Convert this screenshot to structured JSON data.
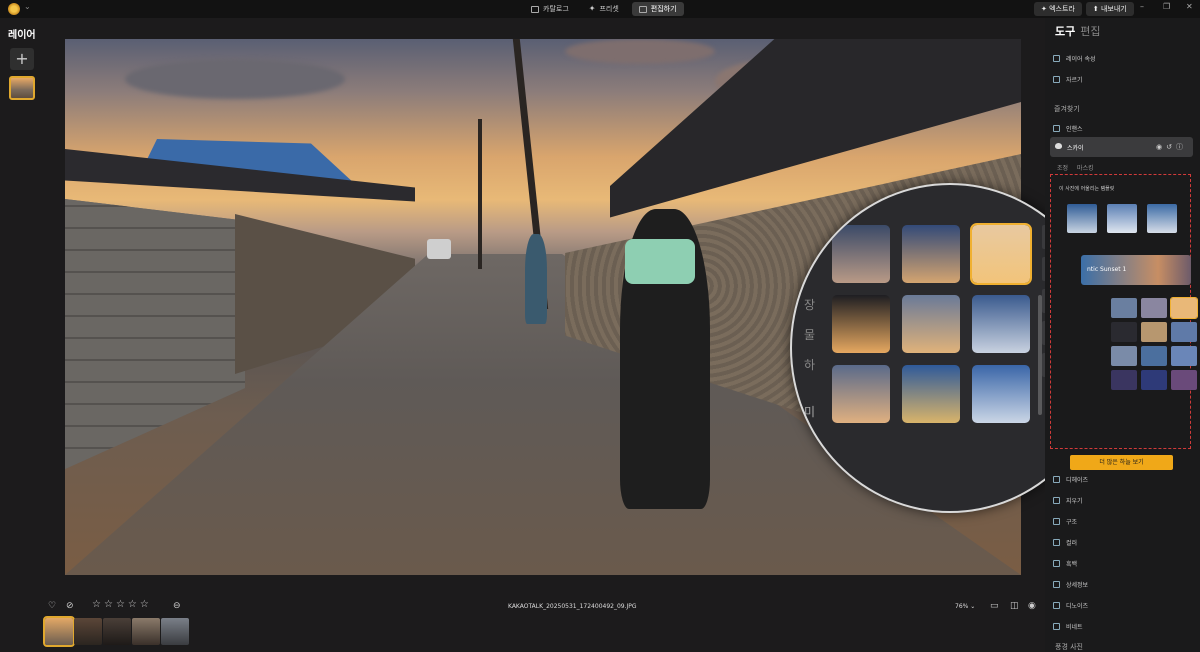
{
  "topbar": {
    "modes": [
      {
        "label": "카탈로그",
        "icon": "catalog-icon"
      },
      {
        "label": "프리셋",
        "icon": "preset-icon"
      },
      {
        "label": "편집하기",
        "icon": "edit-icon",
        "active": true
      }
    ],
    "extra_label": "엑스트라",
    "export_label": "내보내기"
  },
  "left_panel": {
    "title": "레이어",
    "add_symbol": "+"
  },
  "bottom": {
    "filename": "KAKAOTALK_20250531_172400492_09.JPG",
    "zoom": "76%",
    "rating_max": 5
  },
  "magnifier": {
    "left_labels": [
      "장",
      "물",
      "하"
    ],
    "bottom_label": "미"
  },
  "right_panel": {
    "tabs": {
      "active": "도구",
      "inactive": "편집"
    },
    "items_top": [
      {
        "label": "레이어 속성",
        "icon": "layers-icon"
      },
      {
        "label": "자르기",
        "icon": "crop-icon"
      }
    ],
    "favorites_label": "즐겨찾기",
    "enhance_label": "인핸스",
    "sky_label": "스카이",
    "sky_subtabs": [
      "조정",
      "마스킹"
    ],
    "reco_title": "이 사진에 어울리는 템플릿",
    "preset_name": "ntic Sunset 1",
    "more_button": "더 많은 하늘 보기",
    "tools": [
      {
        "label": "디헤이즈",
        "icon": "dehaze-icon"
      },
      {
        "label": "지우기",
        "icon": "erase-icon"
      },
      {
        "label": "구조",
        "icon": "structure-icon"
      },
      {
        "label": "컬러",
        "icon": "color-icon"
      },
      {
        "label": "흑백",
        "icon": "bw-icon"
      },
      {
        "label": "상세정보",
        "icon": "details-icon"
      },
      {
        "label": "디노이즈",
        "icon": "denoise-icon"
      },
      {
        "label": "비네트",
        "icon": "vignette-icon"
      }
    ],
    "footer": "풍경 사진"
  },
  "colors": {
    "accent": "#f0a818",
    "selection": "#e0a82e",
    "dashed_box": "#d23a3a"
  }
}
